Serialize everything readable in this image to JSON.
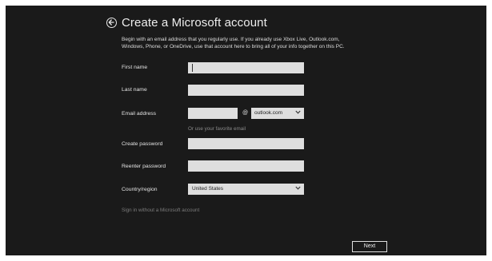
{
  "header": {
    "title": "Create a Microsoft account",
    "back_icon": "back-arrow-icon"
  },
  "intro": {
    "line1": "Begin with an email address that you regularly use. If you already use Xbox Live, Outlook.com,",
    "line2": "Windows, Phone, or OneDrive, use that account here to bring all of your info together on this PC."
  },
  "form": {
    "first_name": {
      "label": "First name",
      "value": ""
    },
    "last_name": {
      "label": "Last name",
      "value": ""
    },
    "email": {
      "label": "Email address",
      "value": "",
      "at_symbol": "@",
      "domain": "outlook.com",
      "hint": "Or use your favorite email"
    },
    "password": {
      "label": "Create password",
      "value": ""
    },
    "reenter_password": {
      "label": "Reenter password",
      "value": ""
    },
    "country": {
      "label": "Country/region",
      "value": "United States"
    }
  },
  "links": {
    "sign_in_without": "Sign in without a Microsoft account"
  },
  "buttons": {
    "next": "Next"
  },
  "colors": {
    "background": "#1a1a1a",
    "field": "#dedede",
    "text": "#e4e4e4",
    "muted": "#7c7c7c"
  }
}
